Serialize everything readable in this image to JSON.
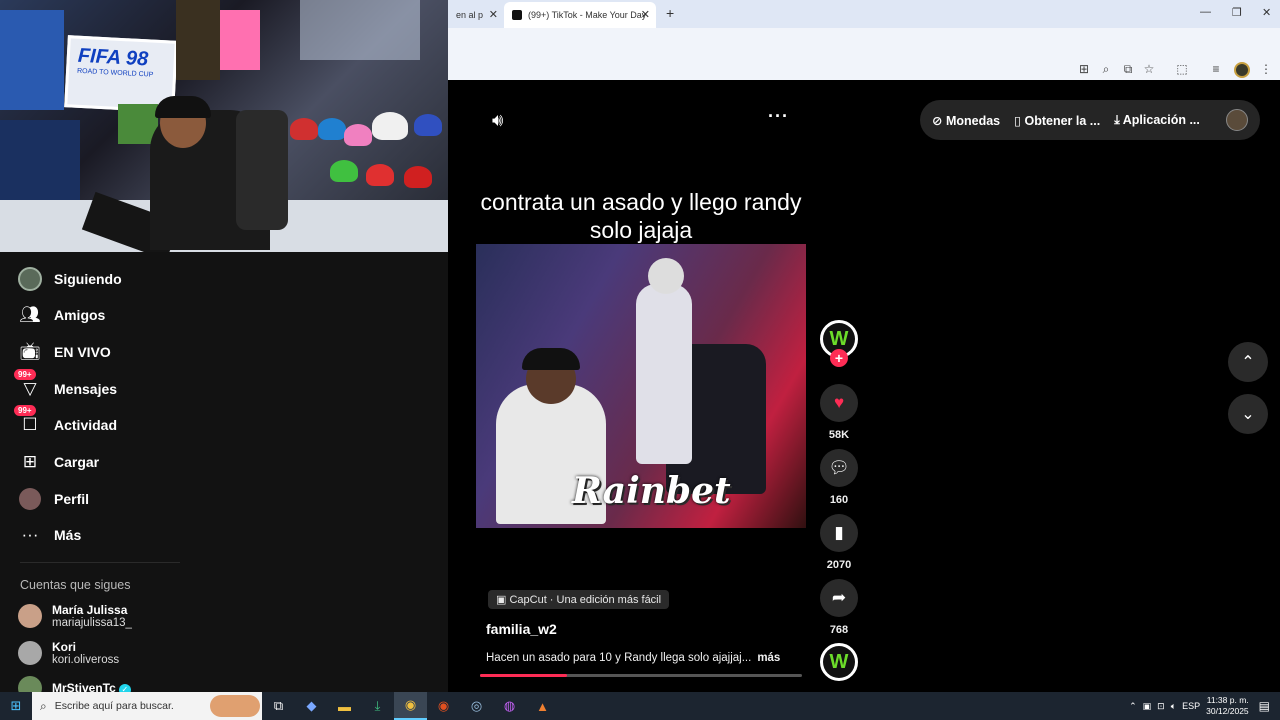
{
  "browser": {
    "tabs": [
      {
        "label": "en al p"
      },
      {
        "label": "(99+) TikTok - Make Your Day"
      }
    ],
    "new_tab_symbol": "+",
    "window_controls": [
      "—",
      "❐",
      "✕"
    ]
  },
  "webcam": {
    "poster_text": "FIFA 98",
    "poster_sub": "ROAD TO WORLD CUP"
  },
  "sidebar": {
    "items": [
      {
        "label": "Siguiendo",
        "icon": "following-avatar-icon"
      },
      {
        "label": "Amigos",
        "icon": "friends-icon"
      },
      {
        "label": "EN VIVO",
        "icon": "live-tv-icon"
      },
      {
        "label": "Mensajes",
        "icon": "messages-icon",
        "badge": "99+"
      },
      {
        "label": "Actividad",
        "icon": "activity-icon",
        "badge": "99+"
      },
      {
        "label": "Cargar",
        "icon": "upload-icon"
      },
      {
        "label": "Perfil",
        "icon": "profile-avatar-icon"
      },
      {
        "label": "Más",
        "icon": "more-icon"
      }
    ],
    "following_title": "Cuentas que sigues",
    "accounts": [
      {
        "name": "María Julissa",
        "username": "mariajulissa13_"
      },
      {
        "name": "Kori",
        "username": "kori.oliveross"
      },
      {
        "name": "MrStivenTc",
        "username": ""
      }
    ]
  },
  "topbar": {
    "coins": "Monedas",
    "get_app": "Obtener la ...",
    "download_app": "Aplicación ..."
  },
  "video": {
    "caption": "contrata un asado y llego randy solo jajaja",
    "watermark": "Rainbet",
    "capcut": "CapCut · Una edición más fácil",
    "author": "familia_w2",
    "description": "Hacen un asado para 10 y Randy llega solo ajajjaj...",
    "more": "más",
    "progress": 0.27
  },
  "actions": {
    "likes": "58K",
    "comments": "160",
    "saves": "2070",
    "shares": "768",
    "avatar_letter": "W"
  },
  "taskbar": {
    "search_placeholder": "Escribe aquí para buscar.",
    "language": "ESP",
    "time": "11:38 p. m.",
    "date": "30/12/2025"
  }
}
